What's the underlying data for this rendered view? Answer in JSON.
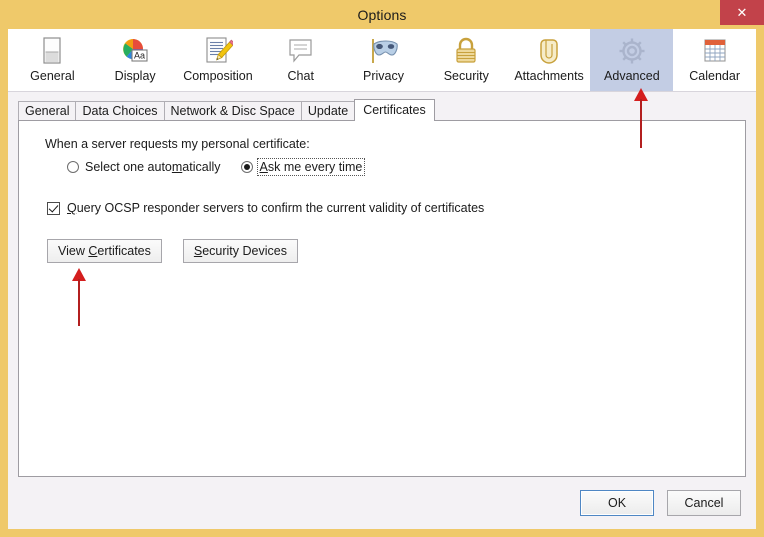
{
  "window": {
    "title": "Options",
    "close_label": "✕",
    "frame_color": "#efc96a",
    "dialog_bg": "#f4f2f5"
  },
  "categories": {
    "selected": "Advanced",
    "selected_bg": "#c3cde4",
    "items": [
      {
        "label": "General",
        "icon": "general-icon"
      },
      {
        "label": "Display",
        "icon": "display-icon"
      },
      {
        "label": "Composition",
        "icon": "composition-icon"
      },
      {
        "label": "Chat",
        "icon": "chat-icon"
      },
      {
        "label": "Privacy",
        "icon": "privacy-mask-icon"
      },
      {
        "label": "Security",
        "icon": "security-lock-icon"
      },
      {
        "label": "Attachments",
        "icon": "attachments-paperclip-icon"
      },
      {
        "label": "Advanced",
        "icon": "advanced-gear-icon"
      },
      {
        "label": "Calendar",
        "icon": "calendar-icon"
      }
    ]
  },
  "tabs": {
    "active": "Certificates",
    "items": [
      {
        "label": "General"
      },
      {
        "label": "Data Choices"
      },
      {
        "label": "Network & Disc Space"
      },
      {
        "label": "Update"
      },
      {
        "label": "Certificates"
      }
    ]
  },
  "panel": {
    "prompt": "When a server requests my personal certificate:",
    "radios": [
      {
        "label_pre": "Select one auto",
        "label_key": "m",
        "label_post": "atically",
        "checked": false,
        "focused": false
      },
      {
        "label_pre": "",
        "label_key": "A",
        "label_post": "sk me every time",
        "checked": true,
        "focused": true
      }
    ],
    "ocsp_checkbox": {
      "checked": true,
      "label_pre": "",
      "label_key": "Q",
      "label_post": "uery OCSP responder servers to confirm the current validity of certificates"
    },
    "buttons": [
      {
        "label_pre": "View ",
        "label_key": "C",
        "label_post": "ertificates"
      },
      {
        "label_pre": "",
        "label_key": "S",
        "label_post": "ecurity Devices"
      }
    ]
  },
  "footer": {
    "ok_label": "OK",
    "cancel_label": "Cancel",
    "ok_border_color": "#4f87c4"
  },
  "annotations": [
    {
      "name": "arrow-view-certificates",
      "points_at": "View Certificates",
      "color": "#d41e1e"
    },
    {
      "name": "arrow-advanced",
      "points_at": "Advanced",
      "color": "#d41e1e"
    }
  ]
}
